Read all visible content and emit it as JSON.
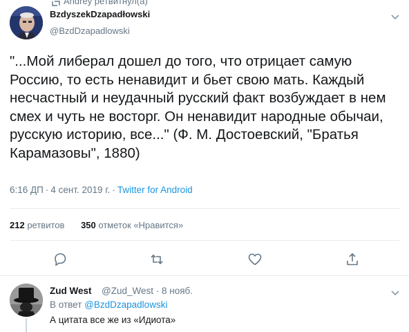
{
  "retweet_banner": {
    "text": "Andrey ретвитнул(а)",
    "icon": "retweet-icon"
  },
  "tweet": {
    "author_name": "BzdyszekDzapadłowski",
    "author_handle": "@BzdDzapadlowski",
    "text": "\"...Мой либерал дошел до того, что отрицает самую Россию, то есть ненавидит и бьет свою мать. Каждый несчастный и неудачный русский факт возбуждает в нем смех и чуть не восторг. Он ненавидит народные обычаи, русскую историю, все...\" (Ф. М. Достоевский, \"Братья Карамазовы\", 1880)",
    "time": "6:16 ДП",
    "date": "4 сент. 2019 г.",
    "source": "Twitter for Android",
    "retweets_count": "212",
    "retweets_label": "ретвитов",
    "likes_count": "350",
    "likes_label": "отметок «Нравится»"
  },
  "actions": {
    "reply_icon": "reply-icon",
    "retweet_icon": "retweet-icon",
    "like_icon": "heart-icon",
    "share_icon": "share-icon"
  },
  "reply": {
    "author_name": "Zud West",
    "author_handle": "@Zud_West",
    "date": "8 нояб.",
    "reply_to_prefix": "В ответ",
    "reply_to_handle": "@BzdDzapadlowski",
    "text": "А цитата все же из «Идиота»"
  },
  "colors": {
    "link": "#1b95e0",
    "secondary_text": "#657786",
    "primary_text": "#14171a",
    "divider": "#e6ecf0"
  }
}
